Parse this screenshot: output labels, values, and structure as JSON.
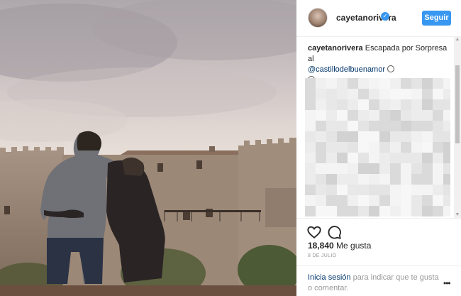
{
  "post": {
    "username": "cayetanorivera",
    "follow_label": "Seguir",
    "caption_user": "cayetanorivera",
    "caption_text": "Escapada por Sorpresa al",
    "caption_mention": "@castillodelbuenamor",
    "likes_count": "18,840",
    "likes_label": "Me gusta",
    "date": "8 DE JULIO",
    "login_link": "Inicia sesión",
    "login_rest": "para indicar que te gusta o comentar."
  },
  "icons": {
    "verified": "verified-badge-icon",
    "like": "heart-icon",
    "comment": "comment-bubble-icon",
    "more": "more-options-icon",
    "emoji": "smiley-emoji-icon"
  },
  "colors": {
    "accent": "#3897f0",
    "link": "#003569",
    "muted": "#999999"
  }
}
